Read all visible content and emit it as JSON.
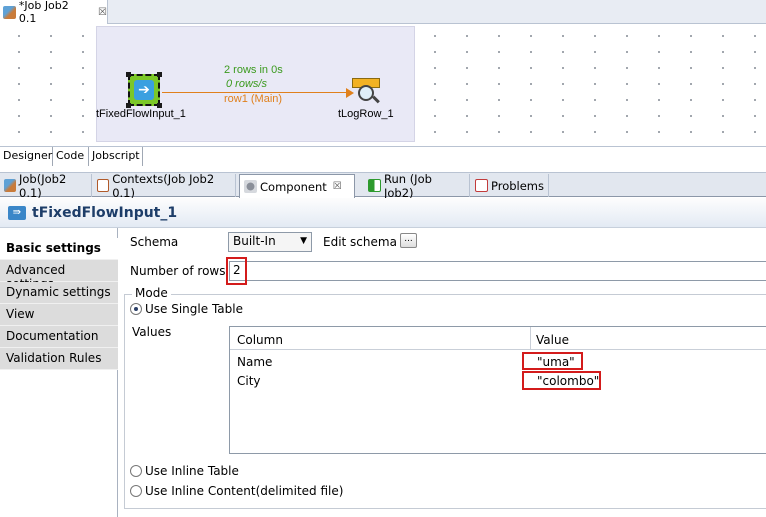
{
  "editor_tab": {
    "title": "*Job Job2 0.1",
    "close": "☒"
  },
  "canvas": {
    "input_component": "tFixedFlowInput_1",
    "output_component": "tLogRow_1",
    "flow_rows": "2 rows in 0s",
    "flow_rate": "0 rows/s",
    "flow_name": "row1 (Main)"
  },
  "designer_tabs": [
    "Designer",
    "Code",
    "Jobscript"
  ],
  "view_tabs": [
    {
      "label": "Job(Job2 0.1)",
      "icon": "job-icon"
    },
    {
      "label": "Contexts(Job Job2 0.1)",
      "icon": "contexts-icon"
    },
    {
      "label": "Component",
      "icon": "component-icon",
      "active": true,
      "close": "☒"
    },
    {
      "label": "Run (Job Job2)",
      "icon": "run-icon"
    },
    {
      "label": "Problems",
      "icon": "problems-icon"
    }
  ],
  "component_title": "tFixedFlowInput_1",
  "nav": [
    "Basic settings",
    "Advanced settings",
    "Dynamic settings",
    "View",
    "Documentation",
    "Validation Rules"
  ],
  "settings": {
    "schema_label": "Schema",
    "schema_value": "Built-In",
    "edit_schema": "Edit schema",
    "edit_schema_btn": "...",
    "num_rows_label": "Number of rows",
    "num_rows_value": "2",
    "mode_legend": "Mode",
    "mode_single": "Use Single Table",
    "values_label": "Values",
    "col_header": "Column",
    "value_header": "Value",
    "rows": [
      {
        "column": "Name",
        "value": "\"uma\""
      },
      {
        "column": "City",
        "value": "\"colombo\""
      }
    ],
    "mode_inline": "Use Inline Table",
    "mode_content": "Use Inline Content(delimited file)"
  },
  "colors": {
    "accent_red": "#d31b1b",
    "flow_orange": "#e0801c",
    "flow_green": "#3b9a1e"
  }
}
